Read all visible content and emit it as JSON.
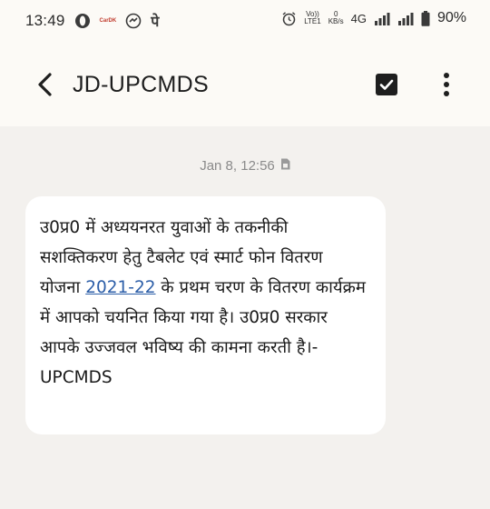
{
  "status_bar": {
    "time": "13:49",
    "left_icons": [
      "opera-icon",
      "cardekho-icon",
      "dial-icon",
      "phonepe-icon"
    ],
    "phonepe_glyph": "पे",
    "cardekho_text": "CarDK",
    "volte_top": "Vo))",
    "volte_bottom": "LTE1",
    "data_speed_top": "0",
    "data_speed_bottom": "KB/s",
    "network": "4G",
    "battery": "90%"
  },
  "app_bar": {
    "title": "JD-UPCMDS"
  },
  "message": {
    "date": "Jan 8, 12:56",
    "text_before_link": "उ0प्र0 में अध्ययनरत युवाओं के तकनीकी सशक्तिकरण हेतु टैबलेट एवं स्मार्ट फोन वितरण योजना ",
    "link_text": "2021-22",
    "text_after_link": " के प्रथम चरण के वितरण कार्यक्रम में आपको चयनित किया गया है। उ0प्र0 सरकार आपके उज्जवल भविष्य की कामना करती है।-UPCMDS"
  },
  "colors": {
    "app_bar_bg": "#fcfaf6",
    "page_bg": "#f3f1ee",
    "bubble_bg": "#ffffff",
    "link": "#2c5ea8"
  }
}
